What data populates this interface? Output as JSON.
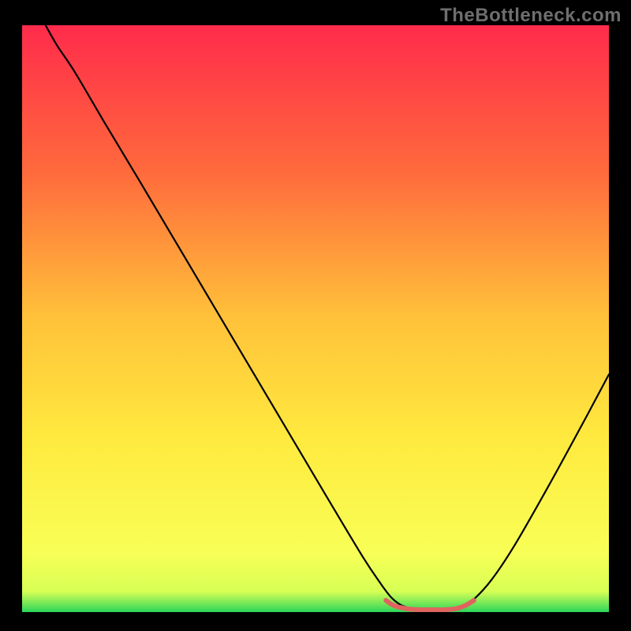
{
  "watermark": "TheBottleneck.com",
  "chart_data": {
    "type": "line",
    "title": "",
    "xlabel": "",
    "ylabel": "",
    "xlim": [
      0,
      100
    ],
    "ylim": [
      0,
      100
    ],
    "gradient_stops": [
      {
        "offset": 0.0,
        "color": "#ff2b4b"
      },
      {
        "offset": 0.25,
        "color": "#ff6a3c"
      },
      {
        "offset": 0.5,
        "color": "#ffc23a"
      },
      {
        "offset": 0.7,
        "color": "#ffe93e"
      },
      {
        "offset": 0.9,
        "color": "#f8ff56"
      },
      {
        "offset": 0.965,
        "color": "#d7ff55"
      },
      {
        "offset": 1.0,
        "color": "#2bd65a"
      }
    ],
    "series": [
      {
        "name": "bottleneck-curve",
        "color": "#000000",
        "width": 2.2,
        "points": [
          {
            "x": 4.0,
            "y": 100.0
          },
          {
            "x": 6.0,
            "y": 96.5
          },
          {
            "x": 9.0,
            "y": 92.0
          },
          {
            "x": 14.0,
            "y": 83.5
          },
          {
            "x": 20.0,
            "y": 73.5
          },
          {
            "x": 28.0,
            "y": 60.0
          },
          {
            "x": 36.0,
            "y": 46.5
          },
          {
            "x": 44.0,
            "y": 33.0
          },
          {
            "x": 52.0,
            "y": 19.5
          },
          {
            "x": 58.0,
            "y": 9.5
          },
          {
            "x": 61.0,
            "y": 5.0
          },
          {
            "x": 63.0,
            "y": 2.4
          },
          {
            "x": 65.0,
            "y": 1.0
          },
          {
            "x": 68.0,
            "y": 0.4
          },
          {
            "x": 72.0,
            "y": 0.4
          },
          {
            "x": 75.0,
            "y": 0.9
          },
          {
            "x": 77.0,
            "y": 2.2
          },
          {
            "x": 80.0,
            "y": 5.5
          },
          {
            "x": 84.0,
            "y": 11.5
          },
          {
            "x": 90.0,
            "y": 22.0
          },
          {
            "x": 96.0,
            "y": 33.0
          },
          {
            "x": 100.0,
            "y": 40.5
          }
        ]
      },
      {
        "name": "optimal-marker",
        "color": "#e0635f",
        "width": 6.0,
        "points": [
          {
            "x": 62.0,
            "y": 2.0
          },
          {
            "x": 63.0,
            "y": 1.3
          },
          {
            "x": 64.0,
            "y": 0.9
          },
          {
            "x": 66.0,
            "y": 0.5
          },
          {
            "x": 68.0,
            "y": 0.4
          },
          {
            "x": 70.0,
            "y": 0.4
          },
          {
            "x": 72.0,
            "y": 0.4
          },
          {
            "x": 74.0,
            "y": 0.6
          },
          {
            "x": 75.5,
            "y": 1.1
          },
          {
            "x": 77.0,
            "y": 2.0
          }
        ]
      }
    ]
  }
}
